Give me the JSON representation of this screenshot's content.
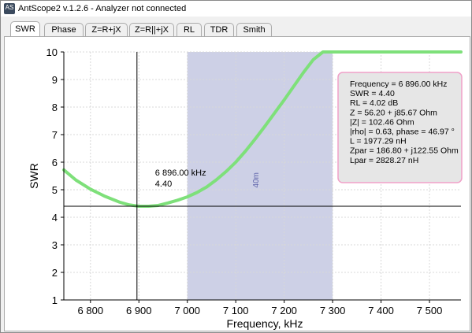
{
  "window": {
    "title": "AntScope2 v.1.2.6 - Analyzer not connected",
    "icon": "AS"
  },
  "tabs": [
    {
      "label": "SWR",
      "active": true
    },
    {
      "label": "Phase",
      "active": false
    },
    {
      "label": "Z=R+jX",
      "active": false
    },
    {
      "label": "Z=R||+jX",
      "active": false
    },
    {
      "label": "RL",
      "active": false
    },
    {
      "label": "TDR",
      "active": false
    },
    {
      "label": "Smith",
      "active": false
    }
  ],
  "colors": {
    "curve": "#7ee07a",
    "band": "#cdd0e6",
    "band_label": "#5a5fa8",
    "info_bg": "#e6e6e6",
    "info_border": "#f0a0c8",
    "cursor": "#000000"
  },
  "chart_data": {
    "type": "line",
    "xlabel": "Frequency, kHz",
    "ylabel": "SWR",
    "xlim": [
      6745,
      7565
    ],
    "ylim": [
      1,
      10
    ],
    "x_ticks": [
      6800,
      6900,
      7000,
      7100,
      7200,
      7300,
      7400,
      7500
    ],
    "x_tick_labels": [
      "6 800",
      "6 900",
      "7 000",
      "7 100",
      "7 200",
      "7 300",
      "7 400",
      "7 500"
    ],
    "y_ticks": [
      1,
      2,
      3,
      4,
      5,
      6,
      7,
      8,
      9,
      10
    ],
    "y_tick_labels": [
      "1",
      "2",
      "3",
      "4",
      "5",
      "6",
      "7",
      "8",
      "9",
      "10"
    ],
    "grid": true,
    "band": {
      "from": 7000,
      "to": 7300,
      "label": "40m"
    },
    "series": [
      {
        "x": [
          6745,
          6770,
          6800,
          6830,
          6860,
          6880,
          6900,
          6920,
          6940,
          6960,
          6980,
          7000,
          7020,
          7040,
          7060,
          7080,
          7100,
          7120,
          7140,
          7160,
          7180,
          7200,
          7220,
          7240,
          7260,
          7280,
          7300,
          7350,
          7400,
          7450,
          7500,
          7565
        ],
        "y": [
          5.72,
          5.35,
          5.02,
          4.76,
          4.55,
          4.45,
          4.4,
          4.4,
          4.43,
          4.52,
          4.62,
          4.74,
          4.9,
          5.1,
          5.36,
          5.66,
          6.0,
          6.4,
          6.84,
          7.3,
          7.78,
          8.26,
          8.76,
          9.26,
          9.72,
          10,
          10,
          10,
          10,
          10,
          10,
          10
        ]
      }
    ],
    "cursor": {
      "x": 6896,
      "y": 4.4,
      "label_freq": "6 896.00 kHz",
      "label_swr": "4.40"
    },
    "info_lines": [
      "Frequency = 6 896.00 kHz",
      "SWR = 4.40",
      "RL = 4.02 dB",
      "Z = 56.20 + j85.67 Ohm",
      "|Z| = 102.46 Ohm",
      "|rho| = 0.63, phase = 46.97 °",
      "L = 1977.29 nH",
      "Zpar = 186.80 + j122.55 Ohm",
      "Lpar = 2828.27 nH"
    ]
  }
}
